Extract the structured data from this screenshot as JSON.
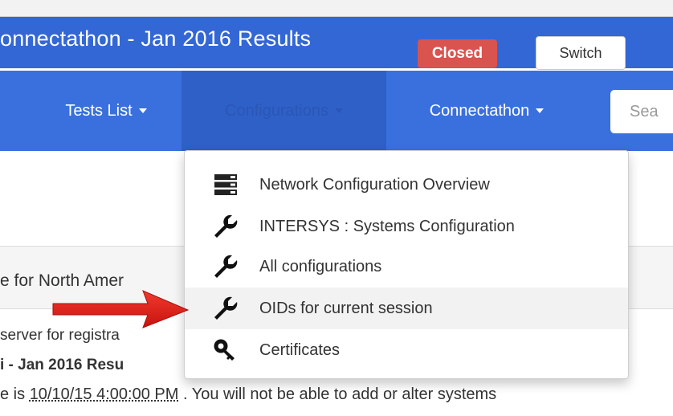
{
  "header": {
    "title": "onnectathon - Jan 2016 Results",
    "status_badge": "Closed",
    "switch_label": "Switch"
  },
  "navbar": {
    "tests_list": "Tests List",
    "configurations": "Configurations",
    "connectathon": "Connectathon",
    "search_placeholder": "Sea"
  },
  "dropdown": {
    "items": [
      {
        "label": "Network Configuration Overview",
        "icon": "server-icon"
      },
      {
        "label": "INTERSYS : Systems Configuration",
        "icon": "wrench-icon"
      },
      {
        "label": "All configurations",
        "icon": "wrench-icon"
      },
      {
        "label": "OIDs for current session",
        "icon": "wrench-icon"
      },
      {
        "label": "Certificates",
        "icon": "key-icon"
      }
    ]
  },
  "page": {
    "subbar_text": "e for North Amer",
    "line1": "server for registra",
    "line2": "i - Jan 2016 Resu",
    "line3_prefix": "e is ",
    "line3_date": "10/10/15 4:00:00 PM",
    "line3_suffix": " . You will not be able to add or alter systems"
  },
  "colors": {
    "navbar": "#3a70dd",
    "titlebar": "#3367d6",
    "badge": "#d9534f",
    "arrow": "#e3201b"
  }
}
